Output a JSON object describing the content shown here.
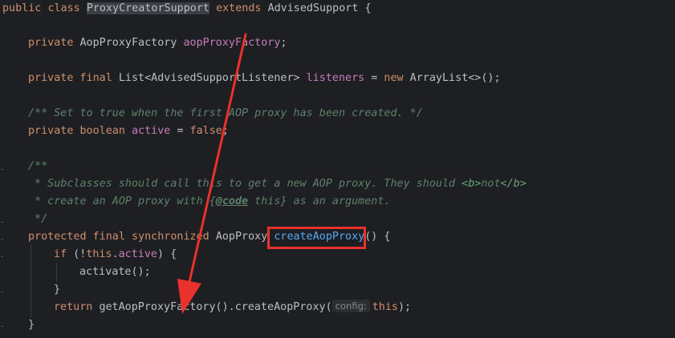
{
  "code": {
    "line1": {
      "kw_public": "public",
      "kw_class": "class",
      "class_name": "ProxyCreatorSupport",
      "kw_extends": "extends",
      "super_name": "AdvisedSupport",
      "brace": "{"
    },
    "line2": {
      "kw_private": "private",
      "type": "AopProxyFactory",
      "field": "aopProxyFactory",
      "semi": ";"
    },
    "line3": {
      "kw_private": "private",
      "kw_final": "final",
      "type": "List<AdvisedSupportListener>",
      "field": "listeners",
      "eq": "=",
      "kw_new": "new",
      "ctor": "ArrayList<>();"
    },
    "line4": {
      "comment": "/** Set to true when the first AOP proxy has been created. */"
    },
    "line5": {
      "kw_private": "private",
      "kw_boolean": "boolean",
      "field": "active",
      "eq": "=",
      "kw_false": "false",
      "semi": ";"
    },
    "line6": {
      "comment": "/**"
    },
    "line7": {
      "comment_start": " * Subclasses should call this to get a new AOP proxy. They should ",
      "tag_open": "<b>",
      "tag_text": "not",
      "tag_close": "</b>"
    },
    "line8": {
      "comment_start": " * create an AOP proxy with ",
      "brace_open": "{",
      "code_tag": "@code",
      "code_text": " this}",
      "comment_end": " as an argument."
    },
    "line9": {
      "comment": " */"
    },
    "line10": {
      "kw_protected": "protected",
      "kw_final": "final",
      "kw_synchronized": "synchronized",
      "type": "AopProxy",
      "method": "createAopProxy",
      "rest": "() {"
    },
    "line11": {
      "kw_if": "if",
      "paren_open": " (!",
      "kw_this": "this",
      "dot": ".",
      "field": "active",
      "rest": ") {"
    },
    "line12": {
      "call": "activate();"
    },
    "line13": {
      "brace": "}"
    },
    "line14": {
      "kw_return": "return",
      "call": "getAopProxyFactory().createAopProxy(",
      "hint": "config:",
      "kw_this": "this",
      "rest": ");"
    },
    "line15": {
      "brace": "}"
    }
  },
  "annotations": {
    "box_color": "#e8322b",
    "arrow_color": "#e8322b"
  }
}
